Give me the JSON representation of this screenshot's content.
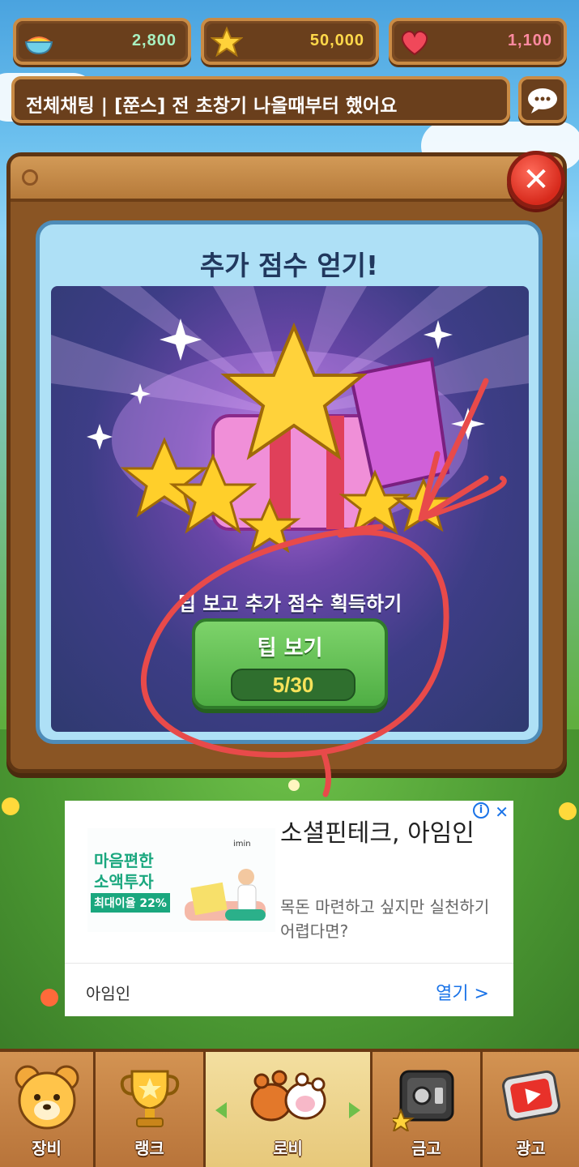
{
  "currencies": [
    {
      "icon": "rainbow-bowl-icon",
      "value": "2,800",
      "color": "#a8f0c0"
    },
    {
      "icon": "star-icon",
      "value": "50,000",
      "color": "#ffd94a"
    },
    {
      "icon": "heart-icon",
      "value": "1,100",
      "color": "#ff8aa0"
    }
  ],
  "chat": {
    "message": "전체채팅 | [쭌스] 전 초창기 나올때부터 했어요",
    "icon": "speech-bubble-icon"
  },
  "modal": {
    "title": "추가 점수 얻기!",
    "subtitle": "팁 보고 추가 점수 획득하기",
    "button_label": "팁 보기",
    "button_count": "5/30",
    "close_icon": "close-icon"
  },
  "ad": {
    "image_line1": "마음편한",
    "image_line2": "소액투자",
    "image_badge": "최대이율 22%",
    "image_brand": "imin",
    "title": "소셜핀테크, 아임인",
    "description": "목돈 마련하고 싶지만 실천하기 어렵다면?",
    "advertiser": "아임인",
    "cta": "열기 >",
    "info_icon": "info-icon",
    "close_icon": "close-icon"
  },
  "nav": {
    "items": [
      {
        "label": "장비",
        "icon": "bear-face-icon"
      },
      {
        "label": "랭크",
        "icon": "trophy-icon"
      },
      {
        "label": "로비",
        "icon": "paws-icon",
        "active": true
      },
      {
        "label": "금고",
        "icon": "safe-icon"
      },
      {
        "label": "광고",
        "icon": "play-video-icon"
      }
    ]
  },
  "colors": {
    "wood": "#a7682e",
    "panel_blue": "#aee0f6",
    "button_green": "#4fae44",
    "count_yellow": "#f6e25a",
    "scribble_red": "#e84a4a"
  }
}
